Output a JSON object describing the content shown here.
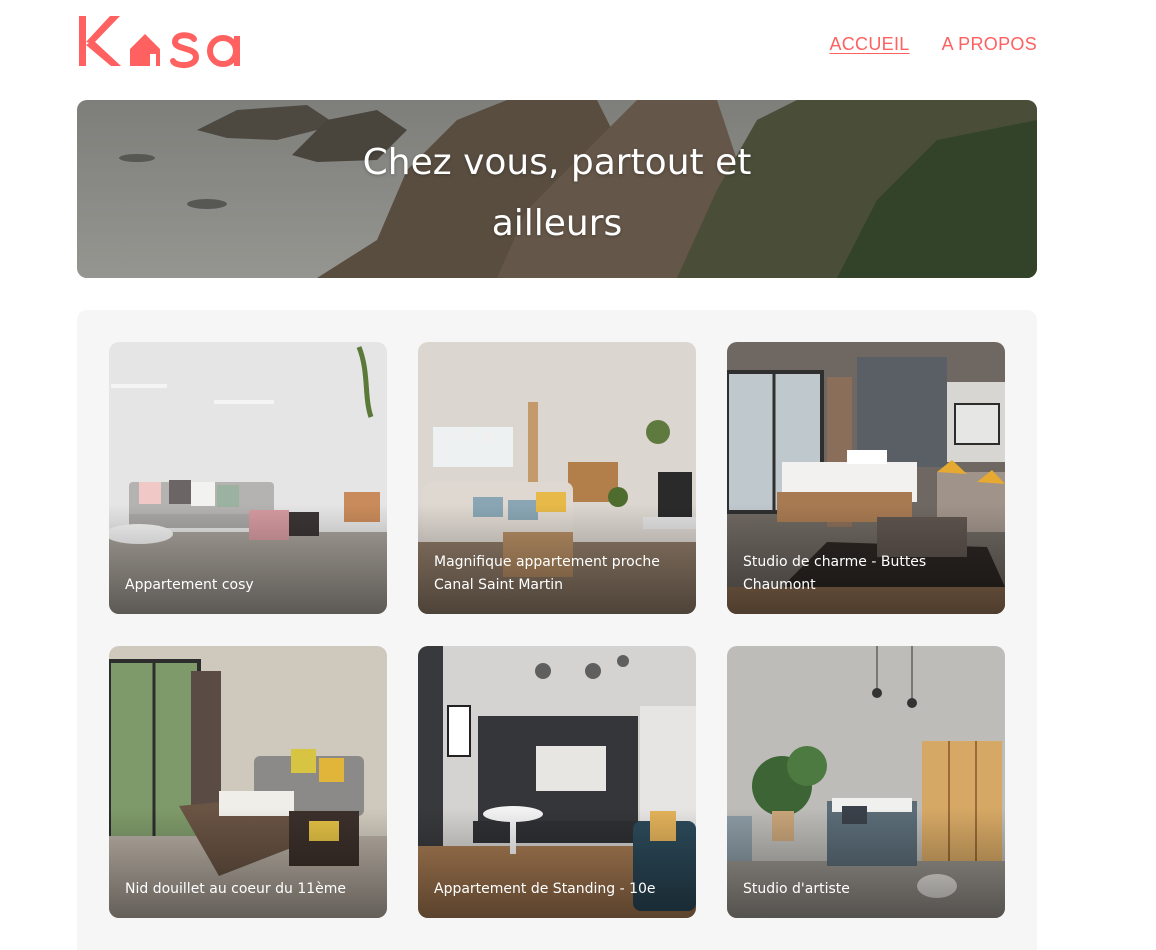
{
  "header": {
    "logo_text": "Kasa",
    "nav": [
      {
        "label": "ACCUEIL",
        "active": true
      },
      {
        "label": "A PROPOS",
        "active": false
      }
    ],
    "brand_color": "#FF6060"
  },
  "banner": {
    "title": "Chez vous, partout et ailleurs"
  },
  "gallery": {
    "background": "#F6F6F6",
    "cards": [
      {
        "title": "Appartement cosy"
      },
      {
        "title": "Magnifique appartement proche Canal Saint Martin"
      },
      {
        "title": "Studio de charme - Buttes Chaumont"
      },
      {
        "title": "Nid douillet au coeur du 11ème"
      },
      {
        "title": "Appartement de Standing - 10e"
      },
      {
        "title": "Studio d'artiste"
      }
    ]
  }
}
